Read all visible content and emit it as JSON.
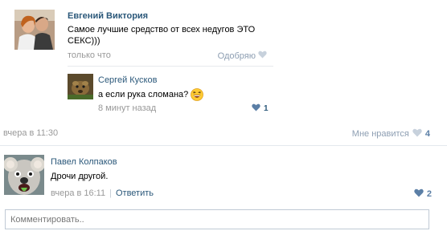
{
  "post": {
    "author": "Евгений Виктория",
    "text": "Самое лучшие средство от всех недугов ЭТО СЕКС)))",
    "time": "только что",
    "approve_label": "Одобряю",
    "footer_time": "вчера в 11:30",
    "like_label": "Мне нравится",
    "like_count": "4"
  },
  "reply": {
    "author": "Сергей Кусков",
    "text": "а если рука сломана?",
    "time": "8 минут назад",
    "like_count": "1"
  },
  "comment": {
    "author": "Павел Колпаков",
    "text": "Дрочи другой.",
    "time": "вчера в 16:11",
    "separator": "|",
    "reply_label": "Ответить",
    "like_count": "2"
  },
  "input": {
    "placeholder": "Комментировать.."
  },
  "colors": {
    "link": "#2b587a",
    "muted": "#999999",
    "heart_active": "#5b7fa6",
    "heart_inactive": "#c7d1dc"
  }
}
